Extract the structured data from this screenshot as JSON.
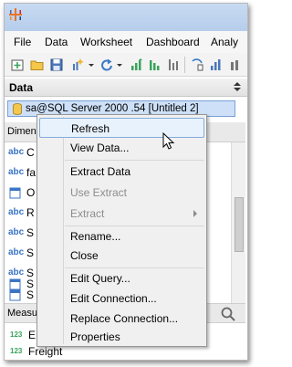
{
  "menubar": {
    "items": [
      "File",
      "Data",
      "Worksheet",
      "Dashboard",
      "Analy"
    ]
  },
  "data_pane": {
    "title": "Data",
    "connection": "sa@SQL Server 2000 .54 [Untitled 2]"
  },
  "dimensions": {
    "title": "Dimens",
    "fields": [
      {
        "icon": "abc",
        "text": "C"
      },
      {
        "icon": "abc",
        "text": "fa"
      },
      {
        "icon": "date",
        "text": "O"
      },
      {
        "icon": "abc",
        "text": "R"
      },
      {
        "icon": "abc",
        "text": "S"
      },
      {
        "icon": "abc",
        "text": "S"
      },
      {
        "icon": "abc",
        "text": "S"
      },
      {
        "icon": "date",
        "text": "S"
      },
      {
        "icon": "date",
        "text": "S"
      }
    ]
  },
  "measures": {
    "title": "Measur",
    "fields": [
      {
        "icon": "123",
        "text": "E"
      },
      {
        "icon": "123",
        "text": "Freight"
      }
    ]
  },
  "context_menu": {
    "items": {
      "refresh": "Refresh",
      "view_data": "View Data...",
      "extract_data": "Extract Data",
      "use_extract": "Use Extract",
      "extract": "Extract",
      "rename": "Rename...",
      "close": "Close",
      "edit_query": "Edit Query...",
      "edit_connection": "Edit Connection...",
      "replace_connection": "Replace Connection...",
      "properties": "Properties"
    }
  },
  "colors": {
    "titlebar": "#c8daf2",
    "selection": "#cde0f7",
    "highlight_border": "#84acdd"
  }
}
